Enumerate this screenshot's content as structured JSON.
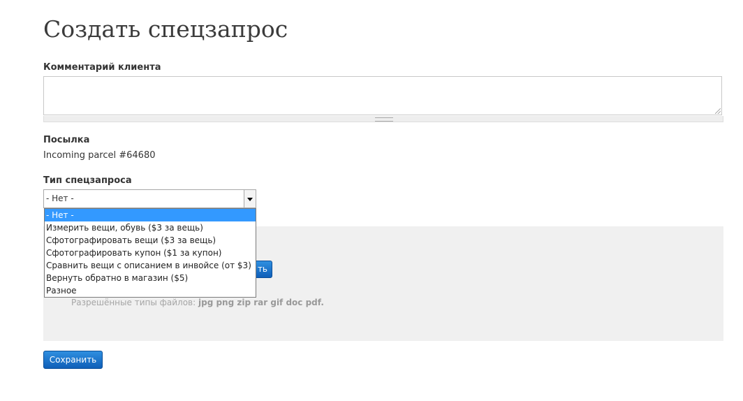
{
  "page": {
    "title": "Создать спецзапрос"
  },
  "comment": {
    "label": "Комментарий клиента",
    "value": ""
  },
  "parcel": {
    "label": "Посылка",
    "value": "Incoming parcel #64680"
  },
  "request_type": {
    "label": "Тип спецзапроса",
    "selected": "- Нет -",
    "options": [
      "- Нет -",
      "Измерить вещи, обувь ($3 за вещь)",
      "Сфотографировать вещи ($3 за вещь)",
      "Сфотографировать купон ($1 за купон)",
      "Сравнить вещи с описанием в инвойсе (от $3)",
      "Вернуть обратно в магазин ($5)",
      "Разное"
    ]
  },
  "upload": {
    "button_label_visible": "ть",
    "allowed_label": "Разрешённые типы файлов:",
    "allowed_types": "jpg png zip rar gif doc pdf."
  },
  "actions": {
    "save_label": "Сохранить"
  },
  "colors": {
    "primary_button": "#1a6fc9",
    "selected_option": "#3399ff",
    "upload_area": "#f0f0f0"
  }
}
